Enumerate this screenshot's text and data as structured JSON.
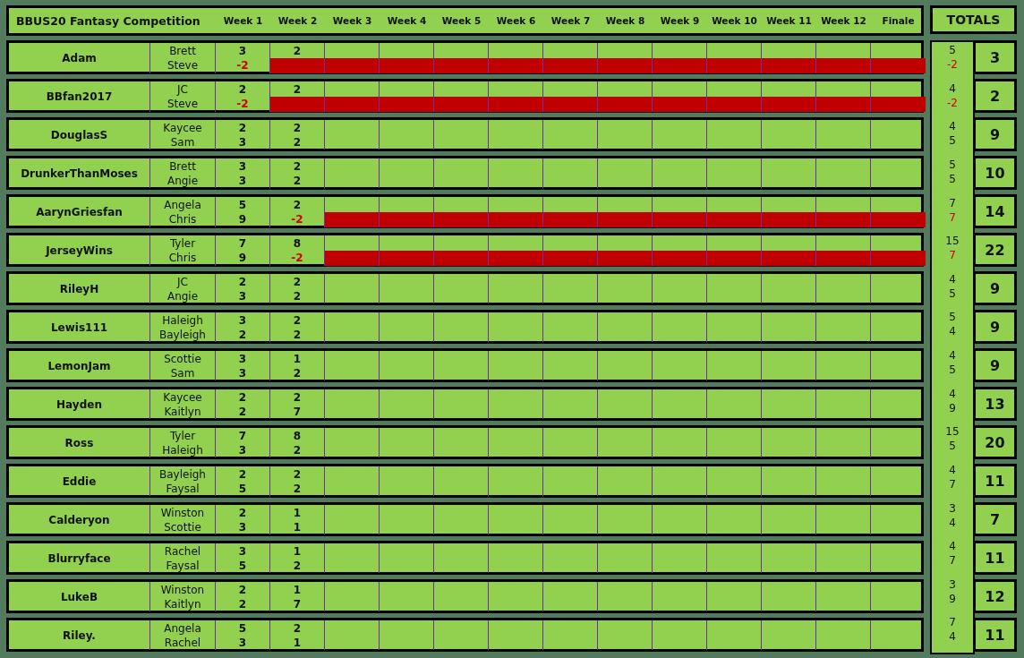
{
  "title": "BBUS20 Fantasy Competition",
  "weeks": [
    "Week 1",
    "Week 2",
    "Week 3",
    "Week 4",
    "Week 5",
    "Week 6",
    "Week 7",
    "Week 8",
    "Week 9",
    "Week 10",
    "Week 11",
    "Week 12",
    "Finale"
  ],
  "totals_label": "TOTALS",
  "players": [
    {
      "name": "Adam",
      "total": "3",
      "picks": [
        {
          "name": "Brett",
          "eliminated": false,
          "scores": [
            "3",
            "2"
          ],
          "subtotal": "5"
        },
        {
          "name": "Steve",
          "eliminated": true,
          "scores": [
            "-2"
          ],
          "subtotal": "-2"
        }
      ]
    },
    {
      "name": "BBfan2017",
      "total": "2",
      "picks": [
        {
          "name": "JC",
          "eliminated": false,
          "scores": [
            "2",
            "2"
          ],
          "subtotal": "4"
        },
        {
          "name": "Steve",
          "eliminated": true,
          "scores": [
            "-2"
          ],
          "subtotal": "-2"
        }
      ]
    },
    {
      "name": "DouglasS",
      "total": "9",
      "picks": [
        {
          "name": "Kaycee",
          "eliminated": false,
          "scores": [
            "2",
            "2"
          ],
          "subtotal": "4"
        },
        {
          "name": "Sam",
          "eliminated": false,
          "scores": [
            "3",
            "2"
          ],
          "subtotal": "5"
        }
      ]
    },
    {
      "name": "DrunkerThanMoses",
      "total": "10",
      "picks": [
        {
          "name": "Brett",
          "eliminated": false,
          "scores": [
            "3",
            "2"
          ],
          "subtotal": "5"
        },
        {
          "name": "Angie",
          "eliminated": false,
          "scores": [
            "3",
            "2"
          ],
          "subtotal": "5"
        }
      ]
    },
    {
      "name": "AarynGriesfan",
      "total": "14",
      "picks": [
        {
          "name": "Angela",
          "eliminated": false,
          "scores": [
            "5",
            "2"
          ],
          "subtotal": "7"
        },
        {
          "name": "Chris",
          "eliminated": true,
          "scores": [
            "9",
            "-2"
          ],
          "subtotal": "7"
        }
      ]
    },
    {
      "name": "JerseyWins",
      "total": "22",
      "picks": [
        {
          "name": "Tyler",
          "eliminated": false,
          "scores": [
            "7",
            "8"
          ],
          "subtotal": "15"
        },
        {
          "name": "Chris",
          "eliminated": true,
          "scores": [
            "9",
            "-2"
          ],
          "subtotal": "7"
        }
      ]
    },
    {
      "name": "RileyH",
      "total": "9",
      "picks": [
        {
          "name": "JC",
          "eliminated": false,
          "scores": [
            "2",
            "2"
          ],
          "subtotal": "4"
        },
        {
          "name": "Angie",
          "eliminated": false,
          "scores": [
            "3",
            "2"
          ],
          "subtotal": "5"
        }
      ]
    },
    {
      "name": "Lewis111",
      "total": "9",
      "picks": [
        {
          "name": "Haleigh",
          "eliminated": false,
          "scores": [
            "3",
            "2"
          ],
          "subtotal": "5"
        },
        {
          "name": "Bayleigh",
          "eliminated": false,
          "scores": [
            "2",
            "2"
          ],
          "subtotal": "4"
        }
      ]
    },
    {
      "name": "LemonJam",
      "total": "9",
      "picks": [
        {
          "name": "Scottie",
          "eliminated": false,
          "scores": [
            "3",
            "1"
          ],
          "subtotal": "4"
        },
        {
          "name": "Sam",
          "eliminated": false,
          "scores": [
            "3",
            "2"
          ],
          "subtotal": "5"
        }
      ]
    },
    {
      "name": "Hayden",
      "total": "13",
      "picks": [
        {
          "name": "Kaycee",
          "eliminated": false,
          "scores": [
            "2",
            "2"
          ],
          "subtotal": "4"
        },
        {
          "name": "Kaitlyn",
          "eliminated": false,
          "scores": [
            "2",
            "7"
          ],
          "subtotal": "9"
        }
      ]
    },
    {
      "name": "Ross",
      "total": "20",
      "picks": [
        {
          "name": "Tyler",
          "eliminated": false,
          "scores": [
            "7",
            "8"
          ],
          "subtotal": "15"
        },
        {
          "name": "Haleigh",
          "eliminated": false,
          "scores": [
            "3",
            "2"
          ],
          "subtotal": "5"
        }
      ]
    },
    {
      "name": "Eddie",
      "total": "11",
      "picks": [
        {
          "name": "Bayleigh",
          "eliminated": false,
          "scores": [
            "2",
            "2"
          ],
          "subtotal": "4"
        },
        {
          "name": "Faysal",
          "eliminated": false,
          "scores": [
            "5",
            "2"
          ],
          "subtotal": "7"
        }
      ]
    },
    {
      "name": "Calderyon",
      "total": "7",
      "picks": [
        {
          "name": "Winston",
          "eliminated": false,
          "scores": [
            "2",
            "1"
          ],
          "subtotal": "3"
        },
        {
          "name": "Scottie",
          "eliminated": false,
          "scores": [
            "3",
            "1"
          ],
          "subtotal": "4"
        }
      ]
    },
    {
      "name": "Blurryface",
      "total": "11",
      "picks": [
        {
          "name": "Rachel",
          "eliminated": false,
          "scores": [
            "3",
            "1"
          ],
          "subtotal": "4"
        },
        {
          "name": "Faysal",
          "eliminated": false,
          "scores": [
            "5",
            "2"
          ],
          "subtotal": "7"
        }
      ]
    },
    {
      "name": "LukeB",
      "total": "12",
      "picks": [
        {
          "name": "Winston",
          "eliminated": false,
          "scores": [
            "2",
            "1"
          ],
          "subtotal": "3"
        },
        {
          "name": "Kaitlyn",
          "eliminated": false,
          "scores": [
            "2",
            "7"
          ],
          "subtotal": "9"
        }
      ]
    },
    {
      "name": "Riley.",
      "total": "11",
      "picks": [
        {
          "name": "Angela",
          "eliminated": false,
          "scores": [
            "5",
            "2"
          ],
          "subtotal": "7"
        },
        {
          "name": "Rachel",
          "eliminated": false,
          "scores": [
            "3",
            "1"
          ],
          "subtotal": "4"
        }
      ]
    }
  ]
}
